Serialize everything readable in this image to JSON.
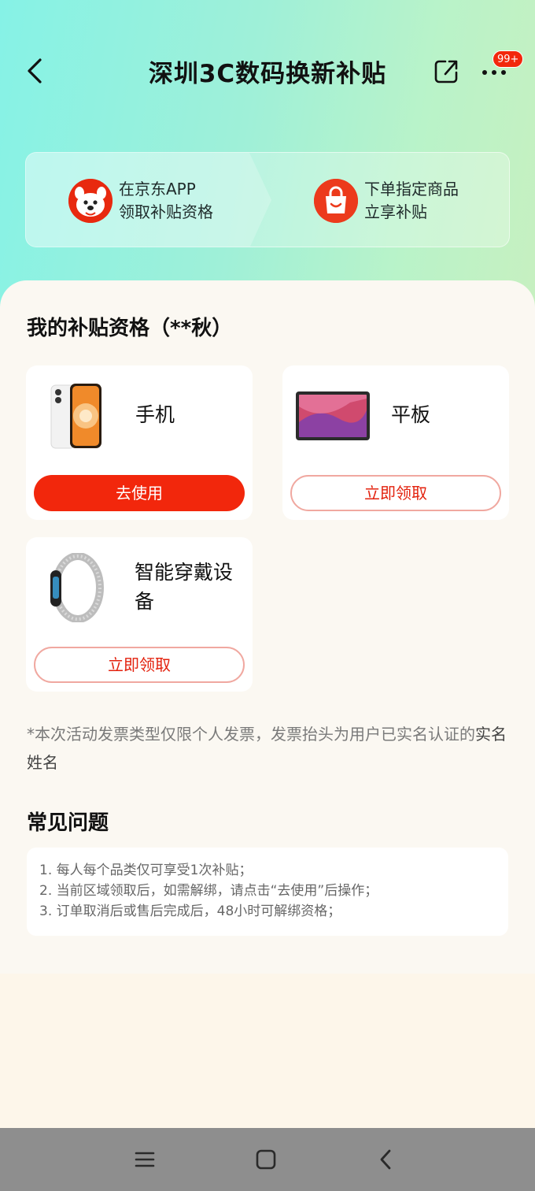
{
  "header": {
    "title": "深圳3C数码换新补贴",
    "badge": "99+"
  },
  "steps": [
    {
      "line1": "在京东APP",
      "line2": "领取补贴资格"
    },
    {
      "line1": "下单指定商品",
      "line2": "立享补贴"
    }
  ],
  "qualification": {
    "title": "我的补贴资格（**秋）",
    "items": [
      {
        "name": "手机",
        "button": "去使用"
      },
      {
        "name": "平板",
        "button": "立即领取"
      },
      {
        "name": "智能穿戴设备",
        "button": "立即领取"
      }
    ]
  },
  "notice": {
    "prefix": "*本次活动发票类型仅限个人发票，发票抬头为用户已实名认证的",
    "emphasis": "实名姓名"
  },
  "faq": {
    "title": "常见问题",
    "items": [
      "1. 每人每个品类仅可享受1次补贴；",
      "2. 当前区域领取后，如需解绑，请点击“去使用”后操作；",
      "3. 订单取消后或售后完成后，48小时可解绑资格；"
    ]
  },
  "colors": {
    "accent": "#f2270c",
    "outline": "#f0a8a0"
  }
}
